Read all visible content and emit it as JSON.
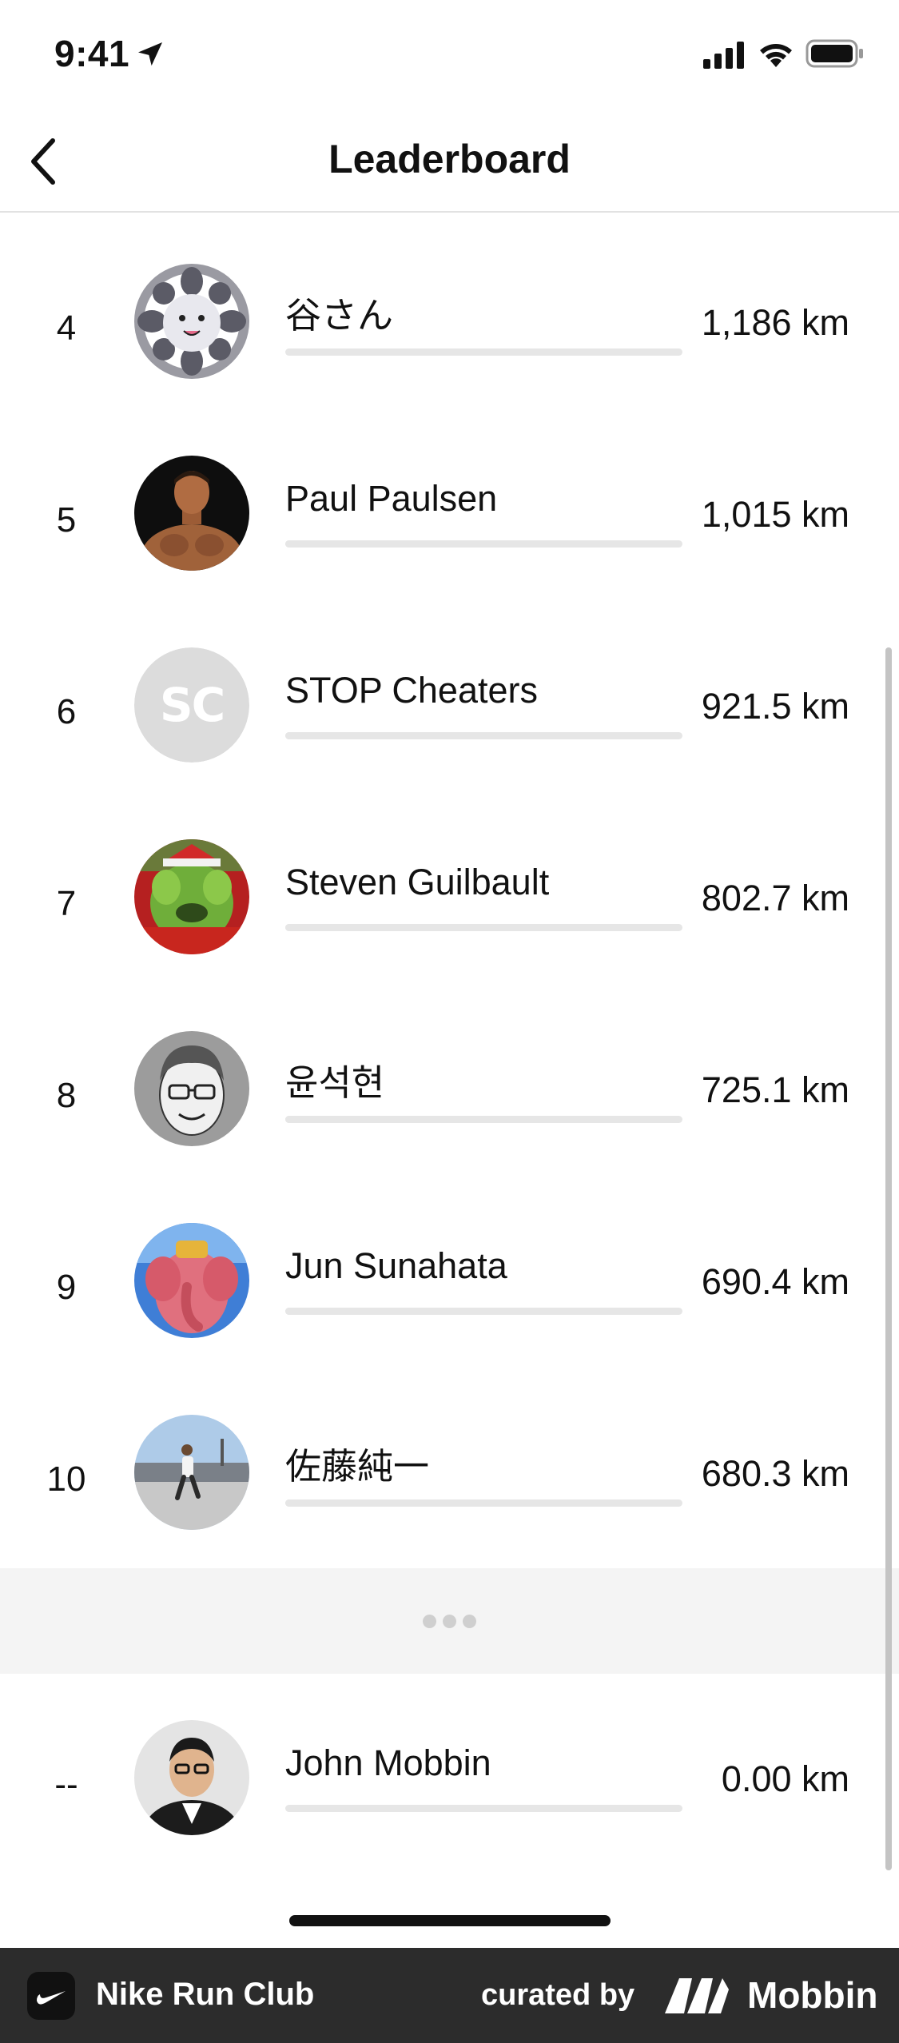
{
  "status_bar": {
    "time": "9:41"
  },
  "header": {
    "title": "Leaderboard"
  },
  "entries": [
    {
      "rank": "4",
      "name": "谷さん",
      "distance": "1,186 km",
      "distance_km": 1186
    },
    {
      "rank": "5",
      "name": "Paul Paulsen",
      "distance": "1,015 km",
      "distance_km": 1015
    },
    {
      "rank": "6",
      "name": "STOP Cheaters",
      "distance": "921.5 km",
      "distance_km": 921.5,
      "initials": "SC"
    },
    {
      "rank": "7",
      "name": "Steven Guilbault",
      "distance": "802.7 km",
      "distance_km": 802.7
    },
    {
      "rank": "8",
      "name": "윤석현",
      "distance": "725.1 km",
      "distance_km": 725.1
    },
    {
      "rank": "9",
      "name": "Jun Sunahata",
      "distance": "690.4 km",
      "distance_km": 690.4
    },
    {
      "rank": "10",
      "name": "佐藤純一",
      "distance": "680.3 km",
      "distance_km": 680.3
    }
  ],
  "self_entry": {
    "rank": "--",
    "name": "John Mobbin",
    "distance": "0.00 km",
    "distance_km": 0
  },
  "footer": {
    "app_name": "Nike Run Club",
    "curated_label": "curated by",
    "brand": "Mobbin"
  },
  "colors": {
    "track": "#e6e6e6",
    "separator_bg": "#f4f4f4",
    "footer_bg": "#2c2c2c",
    "text": "#111111"
  }
}
